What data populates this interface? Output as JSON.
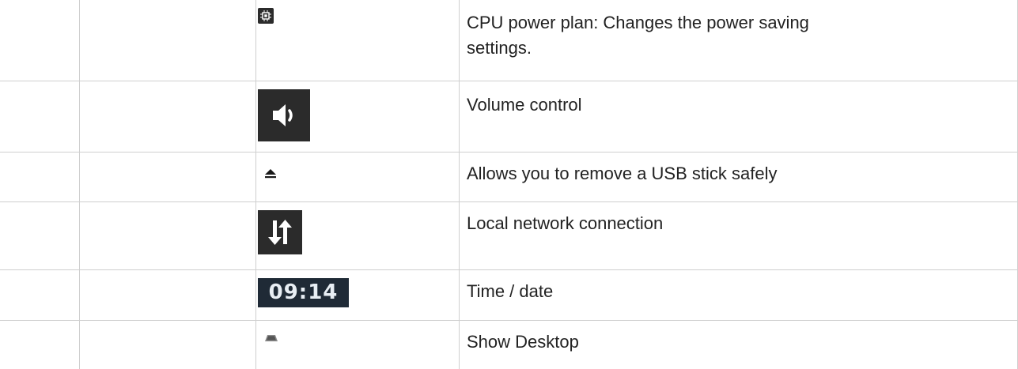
{
  "rows": [
    {
      "icon": "cpu-chip-icon",
      "description_line1": "CPU power plan: Changes the power saving",
      "description_line2": "settings."
    },
    {
      "icon": "volume-speaker-icon",
      "description_line1": "Volume control"
    },
    {
      "icon": "eject-icon",
      "description_line1": "Allows you to remove a USB stick safely"
    },
    {
      "icon": "network-arrows-icon",
      "description_line1": "Local network connection"
    },
    {
      "icon": "clock-icon",
      "icon_text": "09:14",
      "description_line1": "Time / date"
    },
    {
      "icon": "show-desktop-icon",
      "description_line1": "Show Desktop"
    }
  ],
  "colors": {
    "grid": "#cfcfcf",
    "icon_dark": "#2b2b2b",
    "clock_bg": "#1f2a36"
  }
}
